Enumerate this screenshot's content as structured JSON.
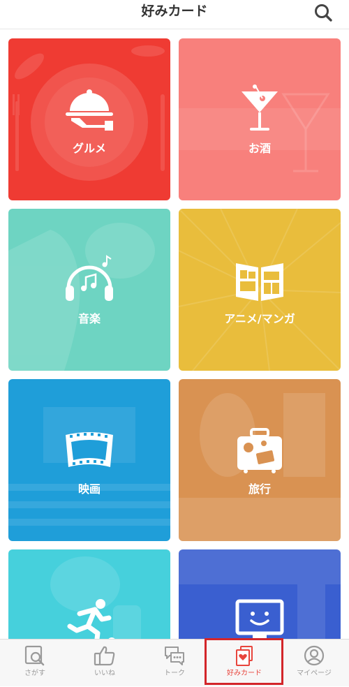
{
  "header": {
    "title": "好みカード",
    "search_icon": "search-icon"
  },
  "colors": {
    "gourmet": "#ef3b33",
    "alcohol": "#f8807c",
    "music": "#6ed4c2",
    "anime": "#e9bd3c",
    "movie": "#1f9ed9",
    "travel": "#d99252",
    "sports": "#46d0dc",
    "gaming": "#3a5fd0",
    "tab_active": "#e8453c",
    "tab_inactive": "#9a9a9a"
  },
  "cards": [
    {
      "label": "グルメ",
      "icon": "cloche-icon"
    },
    {
      "label": "お酒",
      "icon": "cocktail-icon"
    },
    {
      "label": "音楽",
      "icon": "headphones-icon"
    },
    {
      "label": "アニメ/マンガ",
      "icon": "open-book-icon"
    },
    {
      "label": "映画",
      "icon": "film-strip-icon"
    },
    {
      "label": "旅行",
      "icon": "suitcase-icon"
    },
    {
      "label": "",
      "icon": "runner-icon"
    },
    {
      "label": "",
      "icon": "monitor-icon"
    }
  ],
  "tabbar": {
    "tabs": [
      {
        "label": "さがす",
        "icon": "search-icon"
      },
      {
        "label": "いいね",
        "icon": "thumbs-up-icon"
      },
      {
        "label": "トーク",
        "icon": "chat-icon"
      },
      {
        "label": "好みカード",
        "icon": "heart-card-icon"
      },
      {
        "label": "マイページ",
        "icon": "user-icon"
      }
    ],
    "active_index": 3
  }
}
